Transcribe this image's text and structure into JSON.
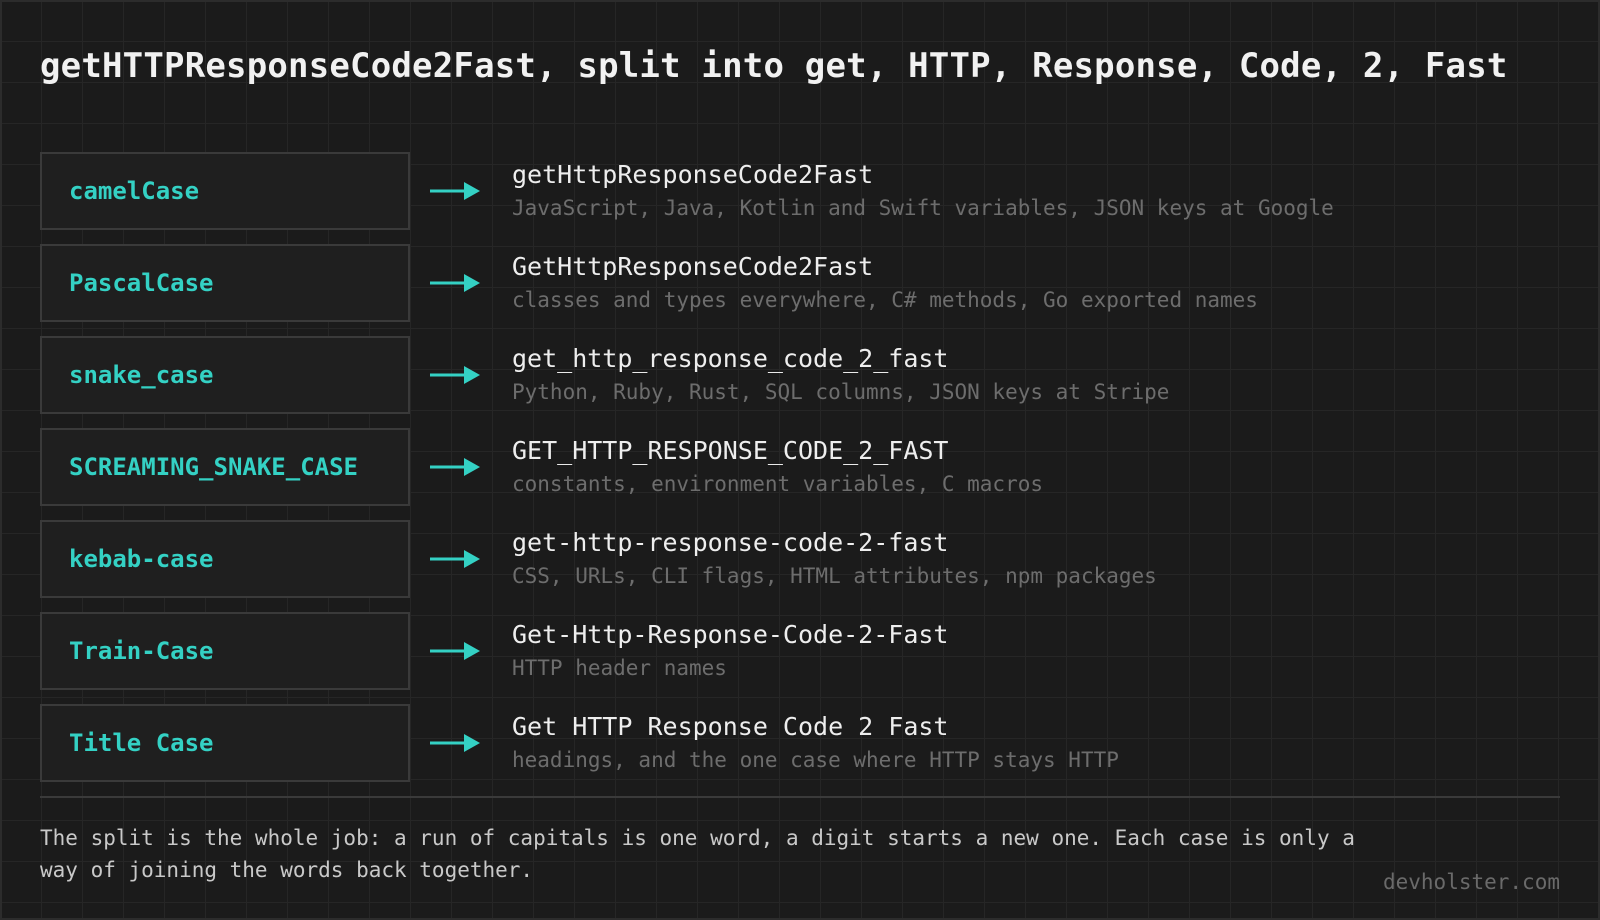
{
  "title": "getHTTPResponseCode2Fast, split into get, HTTP, Response, Code, 2, Fast",
  "accent_color": "#34d1c4",
  "rows": [
    {
      "case": "camelCase",
      "example": "getHttpResponseCode2Fast",
      "usage": "JavaScript, Java, Kotlin and Swift variables, JSON keys at Google"
    },
    {
      "case": "PascalCase",
      "example": "GetHttpResponseCode2Fast",
      "usage": "classes and types everywhere, C# methods, Go exported names"
    },
    {
      "case": "snake_case",
      "example": "get_http_response_code_2_fast",
      "usage": "Python, Ruby, Rust, SQL columns, JSON keys at Stripe"
    },
    {
      "case": "SCREAMING_SNAKE_CASE",
      "example": "GET_HTTP_RESPONSE_CODE_2_FAST",
      "usage": "constants, environment variables, C macros"
    },
    {
      "case": "kebab-case",
      "example": "get-http-response-code-2-fast",
      "usage": "CSS, URLs, CLI flags, HTML attributes, npm packages"
    },
    {
      "case": "Train-Case",
      "example": "Get-Http-Response-Code-2-Fast",
      "usage": "HTTP header names"
    },
    {
      "case": "Title Case",
      "example": "Get HTTP Response Code 2 Fast",
      "usage": "headings, and the one case where HTTP stays HTTP"
    }
  ],
  "note": "The split is the whole job: a run of capitals is one word, a digit starts a new one. Each case is only a way of joining the words back together.",
  "site": "devholster.com",
  "icons": {
    "arrow": "arrow-right-icon"
  }
}
